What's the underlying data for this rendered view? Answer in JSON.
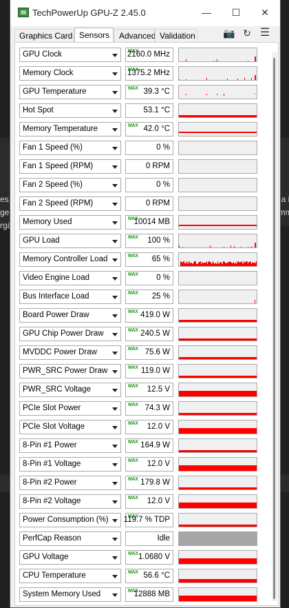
{
  "window": {
    "title": "TechPowerUp GPU-Z 2.45.0"
  },
  "tabs": [
    {
      "label": "Graphics Card"
    },
    {
      "label": "Sensors"
    },
    {
      "label": "Advanced"
    },
    {
      "label": "Validation"
    }
  ],
  "active_tab": "Sensors",
  "background_text": {
    "right": [
      "da i",
      "imm"
    ],
    "left": [
      "es.",
      "ge",
      "rgä"
    ]
  },
  "graph_color": "#ff0000",
  "max_badge": "MAX",
  "sensors": [
    {
      "name": "GPU Clock",
      "value": "2160.0 MHz",
      "max": true,
      "graph": "spikes-low"
    },
    {
      "name": "Memory Clock",
      "value": "1375.2 MHz",
      "max": true,
      "graph": "spikes-low"
    },
    {
      "name": "GPU Temperature",
      "value": "39.3 °C",
      "max": true,
      "graph": "dots-mid"
    },
    {
      "name": "Hot Spot",
      "value": "53.1 °C",
      "max": false,
      "graph": "line-thin"
    },
    {
      "name": "Memory Temperature",
      "value": "42.0 °C",
      "max": true,
      "graph": "line-thin-mid"
    },
    {
      "name": "Fan 1 Speed (%)",
      "value": "0 %",
      "max": false,
      "graph": "none"
    },
    {
      "name": "Fan 1 Speed (RPM)",
      "value": "0 RPM",
      "max": false,
      "graph": "none"
    },
    {
      "name": "Fan 2 Speed (%)",
      "value": "0 %",
      "max": false,
      "graph": "none"
    },
    {
      "name": "Fan 2 Speed (RPM)",
      "value": "0 RPM",
      "max": false,
      "graph": "none"
    },
    {
      "name": "Memory Used",
      "value": "10014 MB",
      "max": true,
      "graph": "line-thin-mid"
    },
    {
      "name": "GPU Load",
      "value": "100 %",
      "max": true,
      "graph": "spikes-low"
    },
    {
      "name": "Memory Controller Load",
      "value": "65 %",
      "max": true,
      "graph": "area-noisy"
    },
    {
      "name": "Video Engine Load",
      "value": "0 %",
      "max": true,
      "graph": "none"
    },
    {
      "name": "Bus Interface Load",
      "value": "25 %",
      "max": true,
      "graph": "spike-end"
    },
    {
      "name": "Board Power Draw",
      "value": "419.0 W",
      "max": true,
      "graph": "line-thin"
    },
    {
      "name": "GPU Chip Power Draw",
      "value": "240.5 W",
      "max": true,
      "graph": "line-thin"
    },
    {
      "name": "MVDDC Power Draw",
      "value": "75.6 W",
      "max": true,
      "graph": "line-thin"
    },
    {
      "name": "PWR_SRC Power Draw",
      "value": "119.0 W",
      "max": true,
      "graph": "line-thin"
    },
    {
      "name": "PWR_SRC Voltage",
      "value": "12.5 V",
      "max": true,
      "graph": "area-half"
    },
    {
      "name": "PCIe Slot Power",
      "value": "74.3 W",
      "max": true,
      "graph": "line-thin"
    },
    {
      "name": "PCIe Slot Voltage",
      "value": "12.0 V",
      "max": true,
      "graph": "area-half"
    },
    {
      "name": "8-Pin #1 Power",
      "value": "164.9 W",
      "max": true,
      "graph": "line-thin"
    },
    {
      "name": "8-Pin #1 Voltage",
      "value": "12.0 V",
      "max": true,
      "graph": "area-half"
    },
    {
      "name": "8-Pin #2 Power",
      "value": "179.8 W",
      "max": true,
      "graph": "line-thin"
    },
    {
      "name": "8-Pin #2 Voltage",
      "value": "12.0 V",
      "max": true,
      "graph": "area-half"
    },
    {
      "name": "Power Consumption (%)",
      "value": "119.7 % TDP",
      "max": true,
      "graph": "line-thin"
    },
    {
      "name": "PerfCap Reason",
      "value": "Idle",
      "max": false,
      "graph": "grey"
    },
    {
      "name": "GPU Voltage",
      "value": "1.0680 V",
      "max": true,
      "graph": "area-half"
    },
    {
      "name": "CPU Temperature",
      "value": "56.6 °C",
      "max": true,
      "graph": "area-thin"
    },
    {
      "name": "System Memory Used",
      "value": "12888 MB",
      "max": true,
      "graph": "area-half"
    }
  ]
}
